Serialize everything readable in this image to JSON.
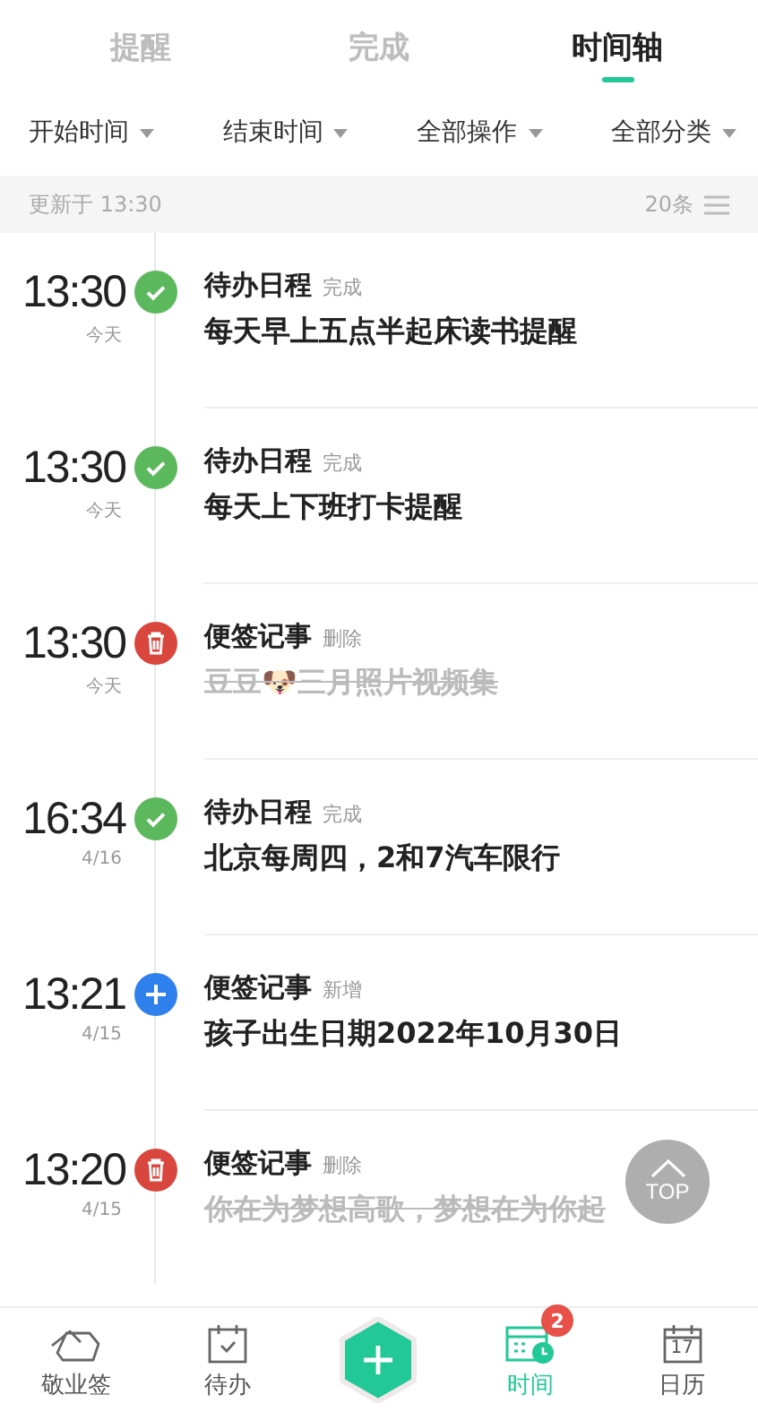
{
  "tabs": [
    {
      "label": "提醒",
      "selected": false
    },
    {
      "label": "完成",
      "selected": false
    },
    {
      "label": "时间轴",
      "selected": true
    }
  ],
  "filters": [
    "开始时间",
    "结束时间",
    "全部操作",
    "全部分类"
  ],
  "update_bar": {
    "text": "更新于 13:30",
    "count": "20条"
  },
  "entries": [
    {
      "time": "13:30",
      "date": "今天",
      "kind": "done",
      "category": "待办日程",
      "action": "完成",
      "content": "每天早上五点半起床读书提醒",
      "struck": false
    },
    {
      "time": "13:30",
      "date": "今天",
      "kind": "done",
      "category": "待办日程",
      "action": "完成",
      "content": "每天上下班打卡提醒",
      "struck": false
    },
    {
      "time": "13:30",
      "date": "今天",
      "kind": "delete",
      "category": "便签记事",
      "action": "删除",
      "content": "豆豆🐶三月照片视频集",
      "struck": true
    },
    {
      "time": "16:34",
      "date": "4/16",
      "kind": "done",
      "category": "待办日程",
      "action": "完成",
      "content": "北京每周四，2和7汽车限行",
      "struck": false
    },
    {
      "time": "13:21",
      "date": "4/15",
      "kind": "add",
      "category": "便签记事",
      "action": "新增",
      "content": "孩子出生日期2022年10月30日",
      "struck": false
    },
    {
      "time": "13:20",
      "date": "4/15",
      "kind": "delete",
      "category": "便签记事",
      "action": "删除",
      "content": "你在为梦想高歌，梦想在为你起",
      "struck": true
    }
  ],
  "top_button": "TOP",
  "nav": [
    {
      "label": "敬业签",
      "kind": "note",
      "selected": false
    },
    {
      "label": "待办",
      "kind": "todo",
      "selected": false
    },
    {
      "kind": "add"
    },
    {
      "label": "时间",
      "kind": "timeline",
      "selected": true,
      "badge": "2"
    },
    {
      "label": "日历",
      "kind": "calendar",
      "selected": false,
      "day": "17"
    }
  ]
}
